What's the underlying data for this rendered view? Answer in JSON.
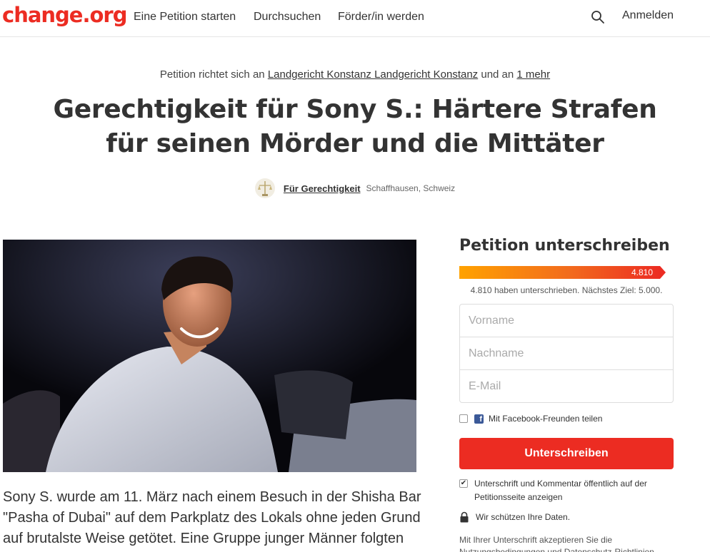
{
  "header": {
    "logo": "change.org",
    "nav": [
      "Eine Petition starten",
      "Durchsuchen",
      "Förder/in werden"
    ],
    "login": "Anmelden"
  },
  "petition": {
    "target_prefix": "Petition richtet sich an",
    "target_name": "Landgericht Konstanz Landgericht Konstanz",
    "target_and": "und an",
    "target_more": "1 mehr",
    "title": "Gerechtigkeit für Sony S.: Härtere Strafen für seinen Mörder und die Mittäter",
    "author": "Für Gerechtigkeit",
    "location": "Schaffhausen, Schweiz",
    "body": "Sony S. wurde am 11. März nach einem Besuch in der Shisha Bar \"Pasha of Dubai\" auf dem Parkplatz des Lokals ohne jeden Grund auf brutalste Weise getötet. Eine Gruppe junger Männer folgten"
  },
  "sign": {
    "title": "Petition unterschreiben",
    "count_label": "4.810",
    "signatures": 4810,
    "goal": 5000,
    "progress_fraction": 0.962,
    "progress_text": "4.810 haben unterschrieben. Nächstes Ziel: 5.000.",
    "placeholders": {
      "first_name": "Vorname",
      "last_name": "Nachname",
      "email": "E-Mail"
    },
    "facebook_label": "Mit Facebook-Freunden teilen",
    "button": "Unterschreiben",
    "public_label": "Unterschrift und Kommentar öffentlich auf der Petitionsseite anzeigen",
    "protect_label": "Wir schützen Ihre Daten.",
    "terms": "Mit Ihrer Unterschrift akzeptieren Sie die Nutzungsbedingungen und Datenschutz-Richtlinien"
  },
  "colors": {
    "brand": "#ec2c22",
    "progress_start": "#ffa200",
    "facebook": "#3b5998"
  },
  "icons": [
    "search-icon",
    "facebook-icon",
    "lock-icon",
    "checkbox-icon"
  ]
}
